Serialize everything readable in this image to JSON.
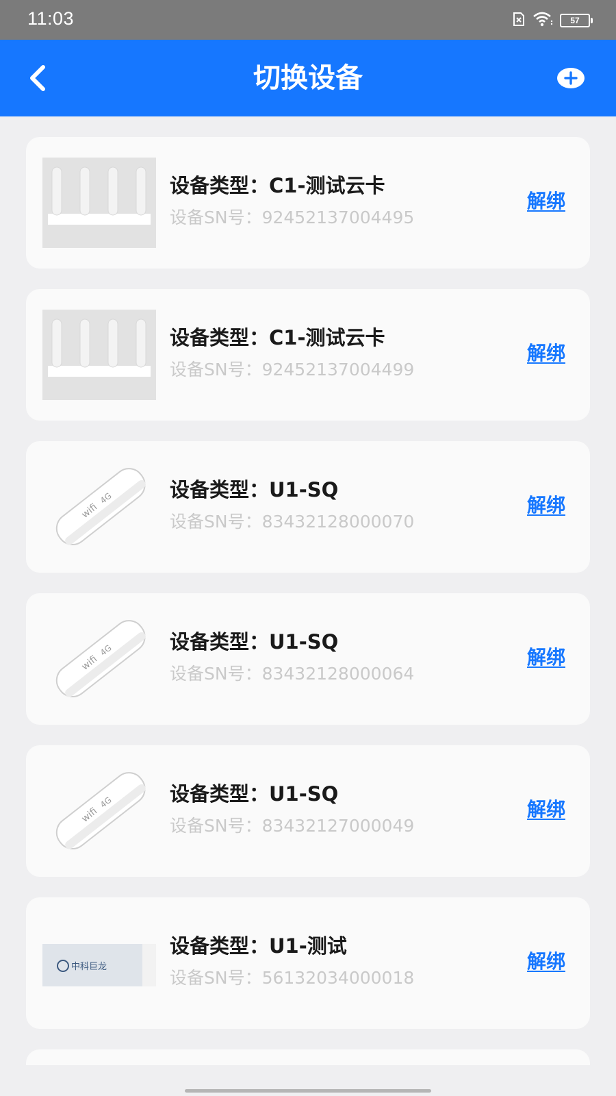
{
  "status_bar": {
    "time": "11:03",
    "battery": "57",
    "icons": [
      "no-sim-icon",
      "wifi-icon",
      "battery-icon"
    ]
  },
  "header": {
    "title": "切换设备",
    "back_icon": "chevron-left-icon",
    "add_icon": "plus-circle-icon"
  },
  "colors": {
    "accent": "#1677ff",
    "background": "#efeff1",
    "card": "#fafafa",
    "sn_text": "#c9c9c9"
  },
  "devices": [
    {
      "type": "设备类型：C1-测试云卡",
      "sn": "设备SN号：92452137004495",
      "action": "解绑",
      "image": "router-image"
    },
    {
      "type": "设备类型：C1-测试云卡",
      "sn": "设备SN号：92452137004499",
      "action": "解绑",
      "image": "router-image"
    },
    {
      "type": "设备类型：U1-SQ",
      "sn": "设备SN号：83432128000070",
      "action": "解绑",
      "image": "usb-dongle-image"
    },
    {
      "type": "设备类型：U1-SQ",
      "sn": "设备SN号：83432128000064",
      "action": "解绑",
      "image": "usb-dongle-image"
    },
    {
      "type": "设备类型：U1-SQ",
      "sn": "设备SN号：83432127000049",
      "action": "解绑",
      "image": "usb-dongle-image"
    },
    {
      "type": "设备类型：U1-测试",
      "sn": "设备SN号：56132034000018",
      "action": "解绑",
      "image": "usb-stick-image",
      "image_label": "中科巨龙"
    }
  ]
}
